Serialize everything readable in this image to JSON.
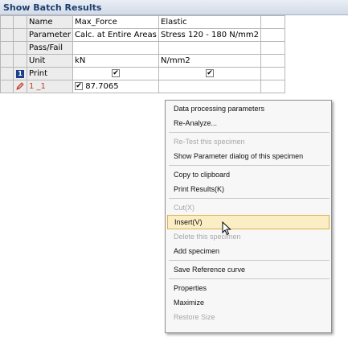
{
  "window": {
    "title": "Show Batch Results"
  },
  "table": {
    "name_row": {
      "label": "Name",
      "col1": "Max_Force",
      "col2": "Elastic"
    },
    "parameter_row": {
      "label": "Parameter",
      "col1": "Calc. at Entire Areas",
      "col2": "Stress 120 - 180 N/mm2"
    },
    "pass_row": {
      "label": "Pass/Fail",
      "col1": "",
      "col2": ""
    },
    "unit_row": {
      "label": "Unit",
      "col1": "kN",
      "col2": "N/mm2"
    },
    "print_row": {
      "label": "Print",
      "indicator": "1",
      "col1_checked": "✔",
      "col2_checked": "✔"
    },
    "data_row": {
      "label": "1 _1",
      "col1_value": "87.7065",
      "col1_checked": "✔",
      "col2_value": ""
    }
  },
  "context_menu": {
    "items": [
      {
        "label": "Data processing parameters",
        "disabled": false
      },
      {
        "label": "Re-Analyze...",
        "disabled": false
      },
      {
        "label": "Re-Test this specimen",
        "disabled": true
      },
      {
        "label": "Show Parameter dialog of this specimen",
        "disabled": false
      },
      {
        "label": "Copy to clipboard",
        "disabled": false
      },
      {
        "label": "Print Results(K)",
        "disabled": false
      },
      {
        "label": "Cut(X)",
        "disabled": true
      },
      {
        "label": "Insert(V)",
        "disabled": false
      },
      {
        "label": "Delete this specimen",
        "disabled": true
      },
      {
        "label": "Add specimen",
        "disabled": false
      },
      {
        "label": "Save Reference curve",
        "disabled": false
      },
      {
        "label": "Properties",
        "disabled": false
      },
      {
        "label": "Maximize",
        "disabled": false
      },
      {
        "label": "Restore Size",
        "disabled": true
      }
    ]
  },
  "colors": {
    "accent": "#1f3e8c",
    "highlight": "#fbeec4",
    "title_text": "#1e3f6e"
  },
  "icons": {
    "indicator": "row-indicator-icon",
    "edit": "edit-pencil-icon",
    "cursor": "mouse-cursor-icon"
  }
}
